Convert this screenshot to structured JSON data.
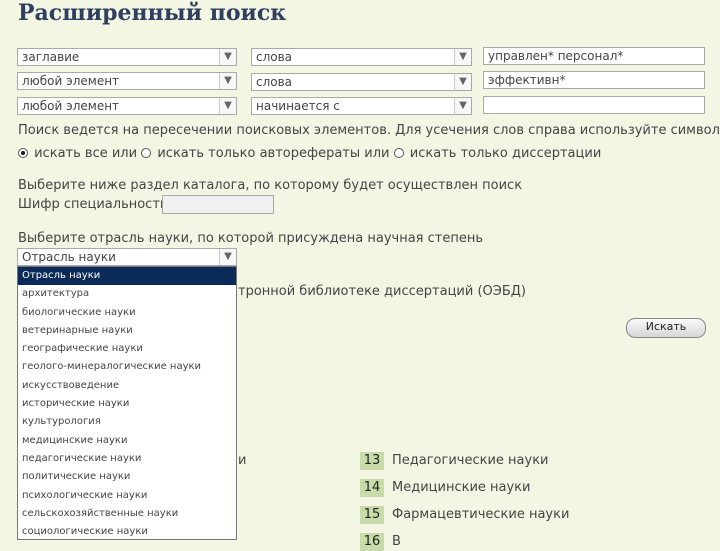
{
  "page_title": "Расширенный поиск",
  "search_rows": [
    {
      "field": "заглавие",
      "mode": "слова",
      "value": "управлен* персонал*"
    },
    {
      "field": "любой элемент",
      "mode": "слова",
      "value": "эффективн*"
    },
    {
      "field": "любой элемент",
      "mode": "начинается с",
      "value": ""
    }
  ],
  "hint": "Поиск ведется на пересечении поисковых элементов. Для усечения слов справа используйте символ *",
  "radio": {
    "opt1": "искать все или",
    "opt2": "искать только авторефераты или",
    "opt3": "искать только диссертации"
  },
  "catalog_label": "Выберите ниже раздел каталога, по которому будет осуществлен поиск",
  "code_label": "Шифр специальности:",
  "branch_label": "Выберите отрасль науки, по которой присуждена научная степень",
  "branch_select": "Отрасль науки",
  "ebd_text": "тронной библиотеке диссертаций (ОЭБД)",
  "search_button": "Искать",
  "dropdown_items": [
    "Отрасль науки",
    "архитектура",
    "биологические науки",
    "ветеринарные науки",
    "географические науки",
    "геолого-минералогические науки",
    "искусствоведение",
    "исторические науки",
    "культурология",
    "медицинские науки",
    "педагогические науки",
    "политические науки",
    "психологические науки",
    "сельскохозяйственные науки",
    "социологические науки"
  ],
  "left_partial": "и",
  "sciences": [
    {
      "num": "13",
      "label": "Педагогические науки"
    },
    {
      "num": "14",
      "label": "Медицинские науки"
    },
    {
      "num": "15",
      "label": "Фармацевтические науки"
    },
    {
      "num": "16",
      "label": "В"
    }
  ]
}
